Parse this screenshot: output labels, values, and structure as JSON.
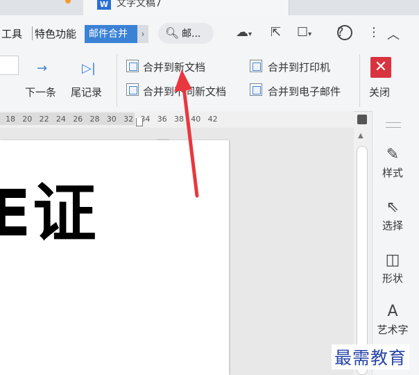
{
  "tabbar": {
    "doc_title": "文字文稿7",
    "doc_icon": "W"
  },
  "menu": {
    "tools": "工具",
    "features": "特色功能",
    "mail_merge": "邮件合并",
    "more": "›",
    "search_label": "邮..."
  },
  "toolbar": {
    "next_label": "下一条",
    "last_label": "尾记录",
    "merge_new_doc": "合并到新文档",
    "merge_diff_doc": "合并到不同新文档",
    "merge_printer": "合并到打印机",
    "merge_email": "合并到电子邮件",
    "close_label": "关闭"
  },
  "ruler": {
    "ticks": [
      "18",
      "20",
      "22",
      "24",
      "26",
      "28",
      "30",
      "32",
      "34",
      "36",
      "38",
      "40",
      "42"
    ]
  },
  "document": {
    "visible_text": "E证"
  },
  "right_panel": {
    "items": [
      {
        "label": "样式",
        "icon": "pen-icon"
      },
      {
        "label": "选择",
        "icon": "cursor-icon"
      },
      {
        "label": "形状",
        "icon": "shapes-icon"
      },
      {
        "label": "艺术字",
        "icon": "wordart-icon"
      }
    ]
  },
  "watermark": "最需教育",
  "colors": {
    "accent": "#3b82d6",
    "close": "#d9333f",
    "arrow": "#e8383d",
    "watermark": "#2744a8"
  }
}
